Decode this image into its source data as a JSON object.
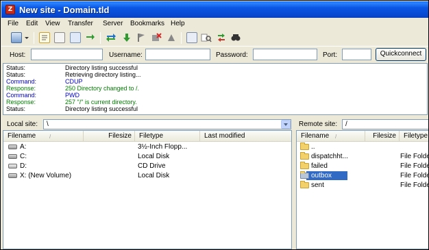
{
  "window": {
    "title": "New site - Domain.tld",
    "app_icon": "filezilla-icon"
  },
  "menu": [
    "File",
    "Edit",
    "View",
    "Transfer",
    "Server",
    "Bookmarks",
    "Help"
  ],
  "toolbar": {
    "icons": [
      "site-manager-icon",
      "dropdown-arrow-icon",
      "toggle-log-icon",
      "toggle-local-tree-icon",
      "toggle-remote-tree-icon",
      "toggle-queue-icon",
      "refresh-icon",
      "process-queue-icon",
      "cancel-icon",
      "disconnect-icon",
      "reconnect-icon",
      "filter-icon",
      "compare-icon",
      "sync-browse-icon",
      "search-icon"
    ]
  },
  "quickconnect": {
    "host_label": "Host:",
    "username_label": "Username:",
    "password_label": "Password:",
    "port_label": "Port:",
    "button_label": "Quickconnect"
  },
  "log": [
    {
      "type": "Status:",
      "message": "Directory listing successful",
      "color": "#000000"
    },
    {
      "type": "Status:",
      "message": "Retrieving directory listing...",
      "color": "#000000"
    },
    {
      "type": "Command:",
      "message": "CDUP",
      "color": "#0000cc"
    },
    {
      "type": "Response:",
      "message": "250 Directory changed to /.",
      "color": "#008000"
    },
    {
      "type": "Command:",
      "message": "PWD",
      "color": "#0000cc"
    },
    {
      "type": "Response:",
      "message": "257 \"/\" is current directory.",
      "color": "#008000"
    },
    {
      "type": "Status:",
      "message": "Directory listing successful",
      "color": "#000000"
    }
  ],
  "local": {
    "site_label": "Local site:",
    "path": "\\",
    "columns": {
      "filename": "Filename",
      "filesize": "Filesize",
      "filetype": "Filetype",
      "modified": "Last modified"
    },
    "rows": [
      {
        "name": "A:",
        "type": "3½-Inch Flopp...",
        "icon": "floppy-drive-icon"
      },
      {
        "name": "C:",
        "type": "Local Disk",
        "icon": "hard-disk-icon"
      },
      {
        "name": "D:",
        "type": "CD Drive",
        "icon": "cd-drive-icon"
      },
      {
        "name": "X: (New Volume)",
        "type": "Local Disk",
        "icon": "hard-disk-icon"
      }
    ]
  },
  "remote": {
    "site_label": "Remote site:",
    "path": "/",
    "columns": {
      "filename": "Filename",
      "filesize": "Filesize",
      "filetype": "Filetype"
    },
    "rows": [
      {
        "name": "..",
        "type": "",
        "icon": "folder-icon"
      },
      {
        "name": "dispatchht...",
        "type": "File Folde",
        "icon": "folder-icon"
      },
      {
        "name": "failed",
        "type": "File Folde",
        "icon": "folder-icon"
      },
      {
        "name": "outbox",
        "type": "File Folde",
        "icon": "folder-icon",
        "selected": true
      },
      {
        "name": "sent",
        "type": "File Folde",
        "icon": "folder-icon"
      }
    ]
  }
}
